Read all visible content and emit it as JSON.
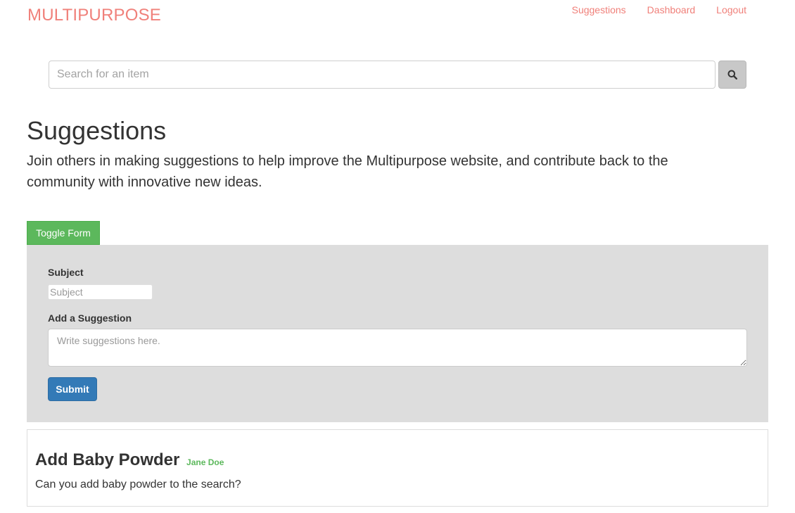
{
  "brand": {
    "name": "MULTIPURPOSE"
  },
  "nav": {
    "items": [
      "Suggestions",
      "Dashboard",
      "Logout"
    ]
  },
  "search": {
    "placeholder": "Search for an item",
    "icon": "search-icon"
  },
  "page": {
    "title": "Suggestions",
    "lead": "Join others in making suggestions to help improve the Multipurpose website, and contribute back to the community with innovative new ideas."
  },
  "form": {
    "toggle_label": "Toggle Form",
    "subject_label": "Subject",
    "subject_placeholder": "Subject",
    "suggestion_label": "Add a Suggestion",
    "suggestion_placeholder": "Write suggestions here.",
    "submit_label": "Submit"
  },
  "suggestions": [
    {
      "title": "Add Baby Powder",
      "author": "Jane Doe",
      "body": "Can you add baby powder to the search?"
    }
  ],
  "colors": {
    "brand": "#f0807a",
    "toggle_green": "#5cb85c",
    "submit_blue": "#337ab7",
    "panel_gray": "#dddddd",
    "author_green": "#5cb85c"
  }
}
